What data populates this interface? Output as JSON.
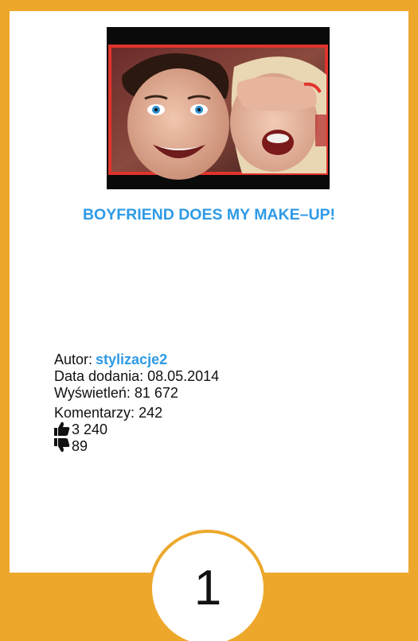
{
  "video": {
    "title": "BOYFRIEND DOES MY MAKE–UP!",
    "thumbnail_icon": "video-thumbnail"
  },
  "meta": {
    "author_label": "Autor:",
    "author_name": "stylizacje2",
    "date_label": "Data dodania:",
    "date_value": "08.05.2014",
    "views_label": "Wyświetleń:",
    "views_value": "81 672",
    "comments_label": "Komentarzy:",
    "comments_value": "242",
    "likes_icon": "thumbs-up-icon",
    "likes_value": "3 240",
    "dislikes_icon": "thumbs-down-icon",
    "dislikes_value": "89"
  },
  "rank": {
    "number": "1"
  },
  "colors": {
    "accent": "#eda82c",
    "link": "#2e9ae6",
    "text": "#111111"
  }
}
